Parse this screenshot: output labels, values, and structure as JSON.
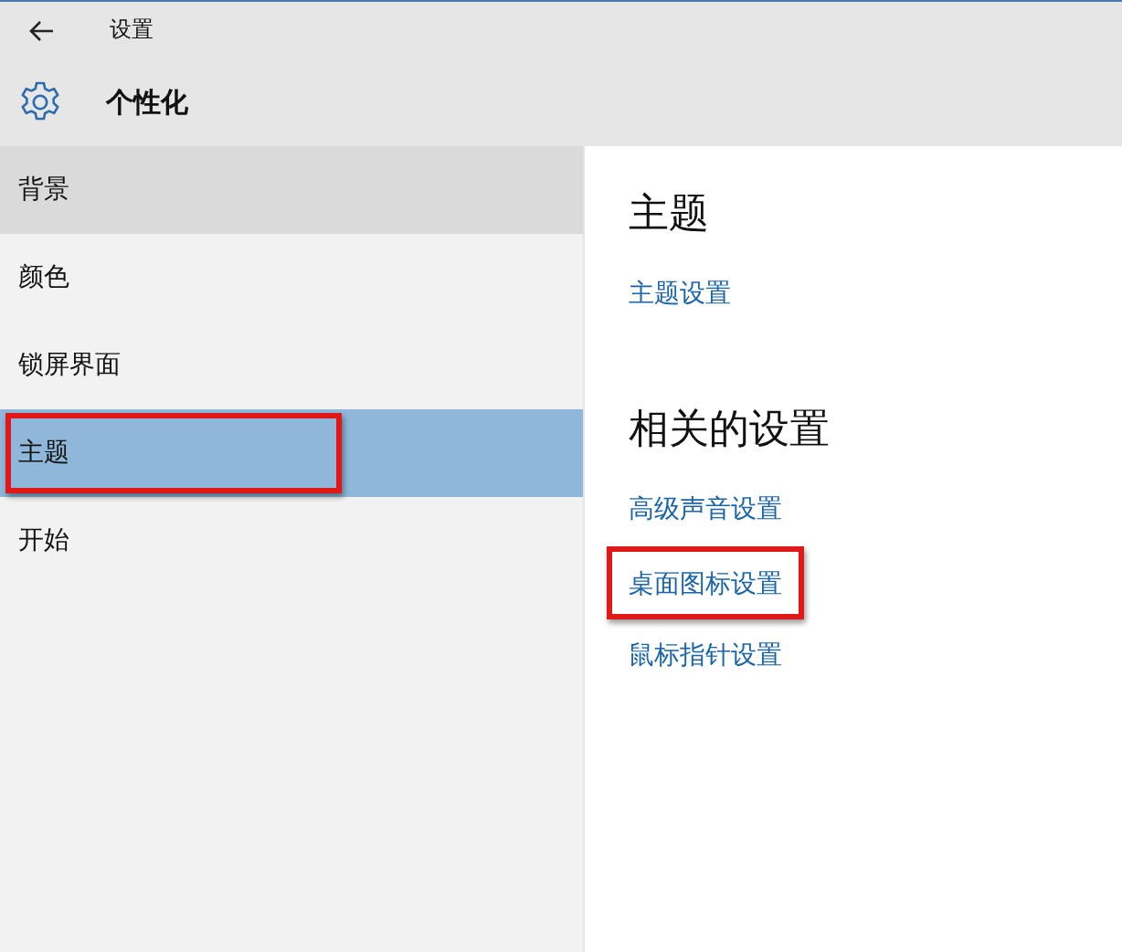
{
  "window": {
    "title": "设置"
  },
  "header": {
    "title": "个性化"
  },
  "sidebar": {
    "items": [
      {
        "label": "背景",
        "selected": false,
        "hovered": true,
        "highlighted": false
      },
      {
        "label": "颜色",
        "selected": false,
        "hovered": false,
        "highlighted": false
      },
      {
        "label": "锁屏界面",
        "selected": false,
        "hovered": false,
        "highlighted": false
      },
      {
        "label": "主题",
        "selected": true,
        "hovered": false,
        "highlighted": true
      },
      {
        "label": "开始",
        "selected": false,
        "hovered": false,
        "highlighted": false
      }
    ]
  },
  "content": {
    "sections": [
      {
        "heading": "主题",
        "links": [
          {
            "label": "主题设置",
            "highlighted": false
          }
        ]
      },
      {
        "heading": "相关的设置",
        "links": [
          {
            "label": "高级声音设置",
            "highlighted": false
          },
          {
            "label": "桌面图标设置",
            "highlighted": true
          },
          {
            "label": "鼠标指针设置",
            "highlighted": false
          }
        ]
      }
    ]
  }
}
